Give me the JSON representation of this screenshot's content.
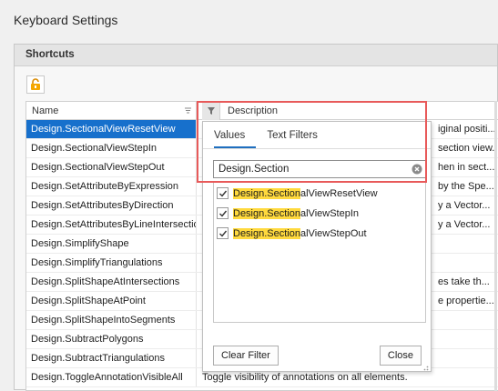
{
  "window": {
    "title": "Keyboard Settings"
  },
  "group": {
    "title": "Shortcuts"
  },
  "grid": {
    "columns": [
      "Name",
      "Description"
    ],
    "rows": [
      {
        "name": "Design.SectionalViewResetView",
        "desc": "iginal positi...",
        "selected": true
      },
      {
        "name": "Design.SectionalViewStepIn",
        "desc": "section view."
      },
      {
        "name": "Design.SectionalViewStepOut",
        "desc": "hen in sect..."
      },
      {
        "name": "Design.SetAttributeByExpression",
        "desc": "by the Spe..."
      },
      {
        "name": "Design.SetAttributesByDirection",
        "desc": "y a Vector..."
      },
      {
        "name": "Design.SetAttributesByLineIntersection",
        "desc": "y a Vector..."
      },
      {
        "name": "Design.SimplifyShape",
        "desc": ""
      },
      {
        "name": "Design.SimplifyTriangulations",
        "desc": ""
      },
      {
        "name": "Design.SplitShapeAtIntersections",
        "desc": "es take th..."
      },
      {
        "name": "Design.SplitShapeAtPoint",
        "desc": "e propertie..."
      },
      {
        "name": "Design.SplitShapeIntoSegments",
        "desc": ""
      },
      {
        "name": "Design.SubtractPolygons",
        "desc": ""
      },
      {
        "name": "Design.SubtractTriangulations",
        "desc": ""
      },
      {
        "name": "Design.ToggleAnnotationVisibleAll",
        "desc": "Toggle visibility of annotations on all elements."
      }
    ]
  },
  "filter_popup": {
    "tabs": [
      "Values",
      "Text Filters"
    ],
    "active_tab": "Values",
    "search_value": "Design.Section",
    "items": [
      {
        "match": "Design.Section",
        "rest": "alViewResetView",
        "checked": true
      },
      {
        "match": "Design.Section",
        "rest": "alViewStepIn",
        "checked": true
      },
      {
        "match": "Design.Section",
        "rest": "alViewStepOut",
        "checked": true
      }
    ],
    "clear_label": "Clear Filter",
    "close_label": "Close"
  },
  "icons": {
    "lock": "unlock-icon",
    "filter": "funnel-icon",
    "clear": "clear-circle-icon",
    "sort": "sort-icon"
  },
  "colors": {
    "selection": "#1770cc",
    "highlight": "#ffd93d",
    "callout": "#e85a5a",
    "tab_underline": "#1f6fbf"
  }
}
